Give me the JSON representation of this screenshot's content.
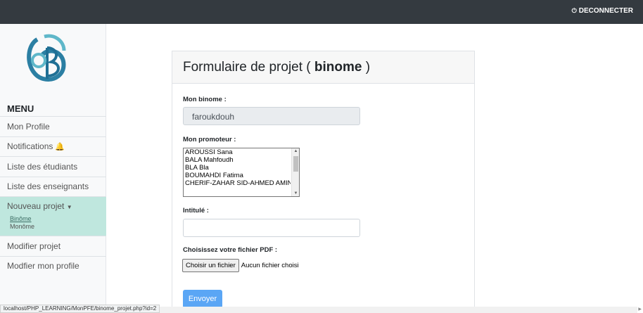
{
  "header": {
    "logout_label": "DECONNECTER",
    "logout_icon": "power-icon"
  },
  "sidebar": {
    "logo_icon": "university-logo",
    "menu_title": "MENU",
    "items": [
      {
        "label": "Mon Profile"
      },
      {
        "label": "Notifications",
        "icon": "bell-icon"
      },
      {
        "label": "Liste des étudiants"
      },
      {
        "label": "Liste des enseignants"
      },
      {
        "label": "Nouveau projet",
        "icon": "caret-down-icon",
        "subitems": [
          "Binôme",
          "Monôme"
        ]
      },
      {
        "label": "Modifier projet"
      },
      {
        "label": "Modfier mon profile"
      }
    ]
  },
  "form": {
    "title_prefix": "Formulaire de projet (",
    "title_bold": "binome",
    "title_suffix": ")",
    "binome_label": "Mon binome :",
    "binome_value": "faroukdouh",
    "promoteur_label": "Mon promoteur :",
    "promoteurs": [
      "AROUSSI Sana",
      "BALA Mahfoudh",
      "BLA Bla",
      "BOUMAHDI Fatima",
      "CHERIF-ZAHAR SID-AHMED AMINE"
    ],
    "intitule_label": "Intitulé :",
    "intitule_value": "",
    "file_label": "Choisissez votre fichier PDF :",
    "file_button": "Choisir un fichier",
    "file_status": "Aucun fichier choisi",
    "submit_label": "Envoyer"
  },
  "statusbar": {
    "url": "localhost/PHP_LEARNING/MonPFE/binome_projet.php?id=2"
  },
  "colors": {
    "topbar": "#343a40",
    "active_nav": "#bfe7de",
    "submit": "#5aa6f5",
    "bell": "#e0352b"
  }
}
